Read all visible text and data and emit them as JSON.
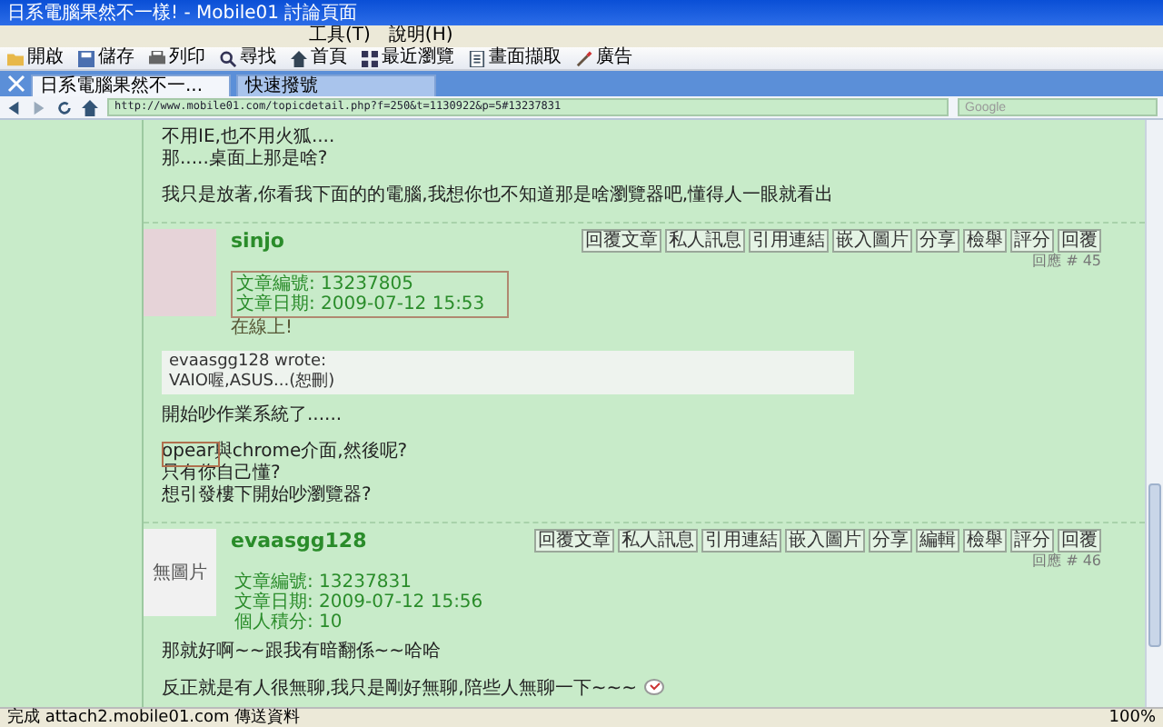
{
  "window": {
    "title": "日系電腦果然不一樣! - Mobile01 討論頁面"
  },
  "menu": [
    {
      "label": "工具(T)"
    },
    {
      "label": "說明(H)"
    }
  ],
  "toolbar": [
    {
      "label": "開啟",
      "kind": "folder"
    },
    {
      "label": "儲存",
      "kind": "disk"
    },
    {
      "label": "列印",
      "kind": "printer"
    },
    {
      "label": "尋找",
      "kind": "search"
    },
    {
      "label": "首頁",
      "kind": "home"
    },
    {
      "label": "最近瀏覽",
      "kind": "list"
    },
    {
      "label": "畫面擷取",
      "kind": "page"
    },
    {
      "label": "廣告",
      "kind": "brush"
    }
  ],
  "tabs": [
    {
      "label": "日系電腦果然不一...",
      "selected": true
    },
    {
      "label": "快速撥號",
      "selected": false
    }
  ],
  "address_bar": {
    "url": "http://www.mobile01.com/topicdetail.php?f=250&t=1130922&p=5#13237831"
  },
  "search": {
    "placeholder": "Google"
  },
  "lead_text": [
    [
      "不用IE,也不用火狐....",
      "那.....桌面上那是啥?"
    ],
    [
      "我只是放著,你看我下面的的電腦,我想你也不知道那是啥瀏覽器吧,懂得人一眼就看出"
    ]
  ],
  "posts": [
    {
      "author": "sinjo",
      "avatar": {
        "kind": "image"
      },
      "online": "在線上!",
      "highlighted": true,
      "info": [
        "文章編號: 13237805",
        "文章日期: 2009-07-12 15:53"
      ],
      "buttons": [
        "回覆文章",
        "私人訊息",
        "引用連結",
        "嵌入圖片",
        "分享",
        "檢舉",
        "評分",
        "回覆"
      ],
      "reply_number": "回應 # 45",
      "quote": {
        "author_line": "evaasgg128 wrote:",
        "text": "VAIO喔,ASUS...(恕刪)"
      },
      "body": [
        [
          "開始吵作業系統了......"
        ],
        [
          "opear與chrome介面,然後呢?",
          "只有你自己懂?",
          "想引發樓下開始吵瀏覽器?"
        ]
      ]
    },
    {
      "author": "evaasgg128",
      "avatar": {
        "kind": "none",
        "label": "無圖片"
      },
      "info": [
        "文章編號: 13237831",
        "文章日期: 2009-07-12 15:56",
        "個人積分: 10"
      ],
      "buttons": [
        "回覆文章",
        "私人訊息",
        "引用連結",
        "嵌入圖片",
        "分享",
        "編輯",
        "檢舉",
        "評分",
        "回覆"
      ],
      "reply_number": "回應 # 46",
      "body": [
        [
          "那就好啊~~跟我有暗翻係~~哈哈"
        ],
        [
          "反正就是有人很無聊,我只是剛好無聊,陪些人無聊一下~~~"
        ]
      ],
      "emoticon": true
    }
  ],
  "status_bar": {
    "text": "完成 attach2.mobile01.com 傳送資料",
    "zoom": "100%"
  }
}
